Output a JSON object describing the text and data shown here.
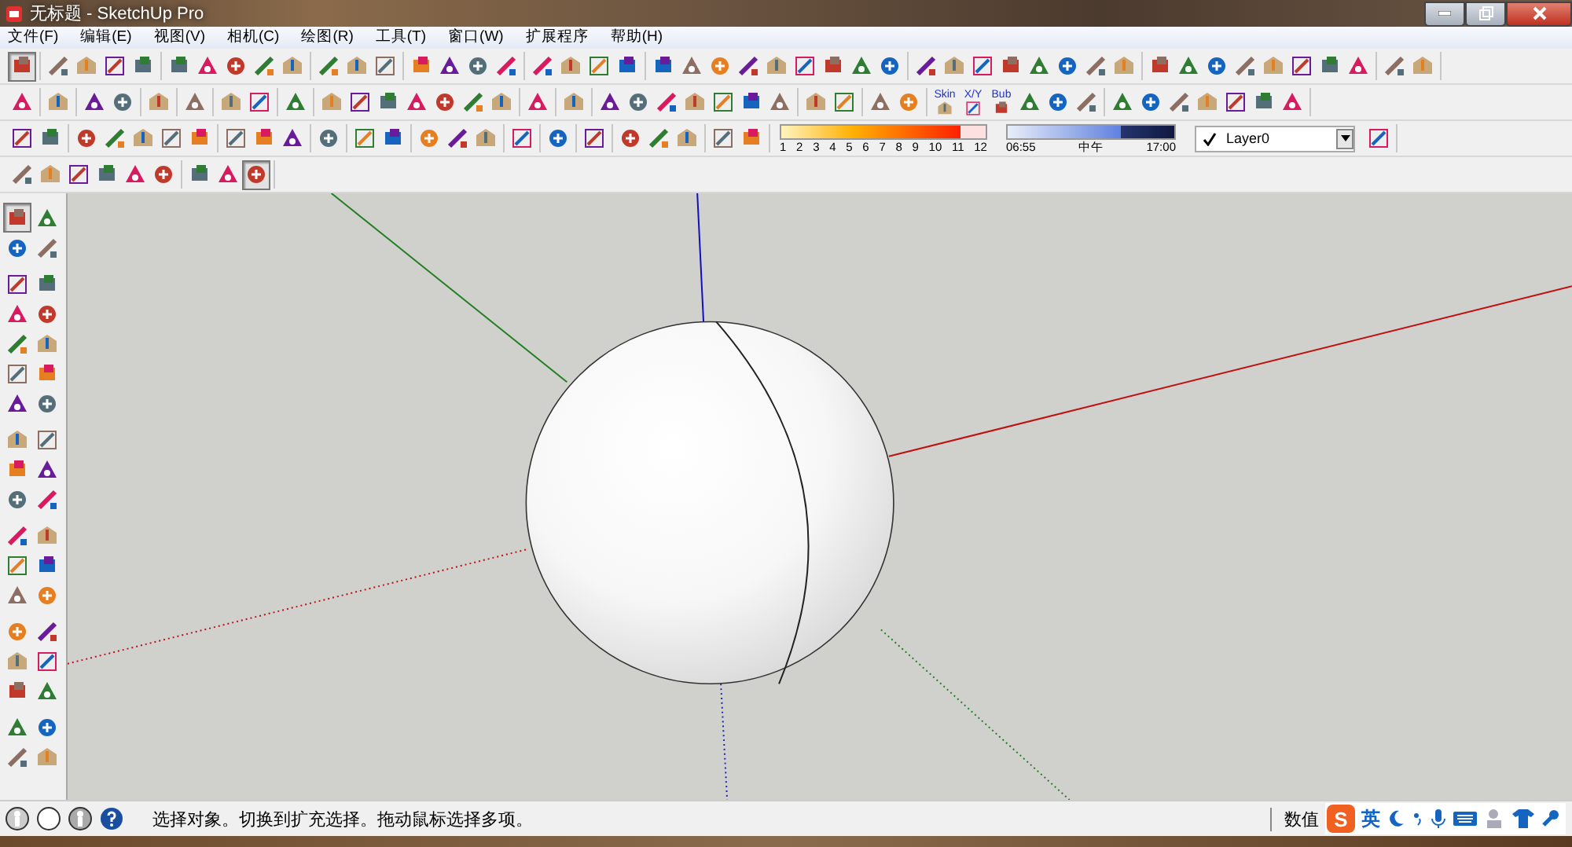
{
  "window": {
    "title": "无标题 - SketchUp Pro"
  },
  "menu": [
    "文件(F)",
    "编辑(E)",
    "视图(V)",
    "相机(C)",
    "绘图(R)",
    "工具(T)",
    "窗口(W)",
    "扩展程序",
    "帮助(H)"
  ],
  "toolbars": [
    {
      "groups": [
        {
          "kind": "tools",
          "tools": [
            {
              "selected": true
            }
          ]
        },
        {
          "kind": "tools",
          "tools": [
            {
              "selected": false
            },
            {
              "selected": false
            },
            {
              "selected": false
            },
            {
              "selected": false
            }
          ]
        },
        {
          "kind": "tools",
          "tools": [
            {
              "selected": false
            },
            {
              "selected": false
            },
            {
              "selected": false
            },
            {
              "selected": false
            },
            {
              "selected": false
            }
          ]
        },
        {
          "kind": "tools",
          "tools": [
            {
              "selected": false
            },
            {
              "selected": false
            },
            {
              "selected": false
            }
          ]
        },
        {
          "kind": "tools",
          "tools": [
            {
              "selected": false
            },
            {
              "selected": false
            },
            {
              "selected": false
            },
            {
              "selected": false
            }
          ]
        },
        {
          "kind": "tools",
          "tools": [
            {
              "selected": false
            },
            {
              "selected": false
            },
            {
              "selected": false
            },
            {
              "selected": false
            }
          ]
        },
        {
          "kind": "tools",
          "tools": [
            {
              "selected": false
            },
            {
              "selected": false
            },
            {
              "selected": false
            },
            {
              "selected": false
            },
            {
              "selected": false
            },
            {
              "selected": false
            },
            {
              "selected": false
            },
            {
              "selected": false
            },
            {
              "selected": false
            }
          ]
        },
        {
          "kind": "tools",
          "tools": [
            {
              "selected": false
            },
            {
              "selected": false
            },
            {
              "selected": false
            },
            {
              "selected": false
            },
            {
              "selected": false
            },
            {
              "selected": false
            },
            {
              "selected": false
            },
            {
              "selected": false
            }
          ]
        },
        {
          "kind": "tools",
          "tools": [
            {
              "selected": false
            },
            {
              "selected": false
            },
            {
              "selected": false
            },
            {
              "selected": false
            },
            {
              "selected": false
            },
            {
              "selected": false
            },
            {
              "selected": false
            },
            {
              "selected": false
            }
          ]
        },
        {
          "kind": "tools",
          "tools": [
            {
              "selected": false
            },
            {
              "selected": false
            }
          ]
        }
      ]
    },
    {
      "groups": [
        {
          "kind": "tools",
          "tools": [
            {
              "selected": false
            }
          ]
        },
        {
          "kind": "tools",
          "tools": [
            {
              "selected": false
            }
          ]
        },
        {
          "kind": "tools",
          "tools": [
            {
              "selected": false
            },
            {
              "selected": false
            }
          ]
        },
        {
          "kind": "tools",
          "tools": [
            {
              "selected": false
            }
          ]
        },
        {
          "kind": "tools",
          "tools": [
            {
              "selected": false
            }
          ]
        },
        {
          "kind": "tools",
          "tools": [
            {
              "selected": false
            },
            {
              "selected": false
            }
          ]
        },
        {
          "kind": "tools",
          "tools": [
            {
              "selected": false
            }
          ]
        },
        {
          "kind": "tools",
          "tools": [
            {
              "selected": false
            },
            {
              "selected": false
            },
            {
              "selected": false
            },
            {
              "selected": false
            },
            {
              "selected": false
            },
            {
              "selected": false
            },
            {
              "selected": false
            }
          ]
        },
        {
          "kind": "tools",
          "tools": [
            {
              "selected": false
            }
          ]
        },
        {
          "kind": "tools",
          "tools": [
            {
              "selected": false
            }
          ]
        },
        {
          "kind": "tools",
          "tools": [
            {
              "selected": false
            },
            {
              "selected": false
            },
            {
              "selected": false
            },
            {
              "selected": false
            },
            {
              "selected": false
            },
            {
              "selected": false
            },
            {
              "selected": false
            }
          ]
        },
        {
          "kind": "tools",
          "tools": [
            {
              "selected": false
            },
            {
              "selected": false
            }
          ]
        },
        {
          "kind": "tools",
          "tools": [
            {
              "selected": false
            },
            {
              "selected": false
            }
          ]
        },
        {
          "kind": "tools",
          "tools": [
            {
              "selected": false,
              "label": "Skin"
            },
            {
              "selected": false,
              "label": "X/Y"
            },
            {
              "selected": false,
              "label": "Bub"
            },
            {
              "selected": false
            },
            {
              "selected": false
            },
            {
              "selected": false
            }
          ]
        },
        {
          "kind": "tools",
          "tools": [
            {
              "selected": false
            },
            {
              "selected": false
            },
            {
              "selected": false
            },
            {
              "selected": false
            },
            {
              "selected": false
            },
            {
              "selected": false
            },
            {
              "selected": false
            }
          ]
        }
      ]
    },
    {
      "groups": [
        {
          "kind": "tools",
          "tools": [
            {
              "selected": false
            },
            {
              "selected": false
            }
          ]
        },
        {
          "kind": "tools",
          "tools": [
            {
              "selected": false
            },
            {
              "selected": false
            },
            {
              "selected": false
            },
            {
              "selected": false
            },
            {
              "selected": false
            }
          ]
        },
        {
          "kind": "tools",
          "tools": [
            {
              "selected": false
            },
            {
              "selected": false
            },
            {
              "selected": false
            }
          ]
        },
        {
          "kind": "tools",
          "tools": [
            {
              "selected": false
            }
          ]
        },
        {
          "kind": "tools",
          "tools": [
            {
              "selected": false
            },
            {
              "selected": false
            }
          ]
        },
        {
          "kind": "tools",
          "tools": [
            {
              "selected": false
            },
            {
              "selected": false
            },
            {
              "selected": false
            }
          ]
        },
        {
          "kind": "tools",
          "tools": [
            {
              "selected": false
            }
          ]
        },
        {
          "kind": "tools",
          "tools": [
            {
              "selected": false
            }
          ]
        },
        {
          "kind": "tools",
          "tools": [
            {
              "selected": false
            }
          ]
        },
        {
          "kind": "tools",
          "tools": [
            {
              "selected": false
            },
            {
              "selected": false
            },
            {
              "selected": false
            }
          ]
        },
        {
          "kind": "tools",
          "tools": [
            {
              "selected": false
            },
            {
              "selected": false
            }
          ]
        },
        {
          "kind": "shadow_scale",
          "labels": [
            "1",
            "2",
            "3",
            "4",
            "5",
            "6",
            "7",
            "8",
            "9",
            "10",
            "11",
            "12"
          ],
          "level": 0.88
        },
        {
          "kind": "time_scale",
          "start": "06:55",
          "middle": "中午",
          "end": "17:00",
          "level": 0.68
        },
        {
          "kind": "layer",
          "value": "Layer0",
          "checked": true
        },
        {
          "kind": "tools",
          "tools": [
            {
              "selected": false
            }
          ]
        }
      ]
    },
    {
      "groups": [
        {
          "kind": "tools",
          "tools": [
            {
              "selected": false
            },
            {
              "selected": false
            },
            {
              "selected": false
            },
            {
              "selected": false
            },
            {
              "selected": false
            },
            {
              "selected": false
            }
          ]
        },
        {
          "kind": "tools",
          "tools": [
            {
              "selected": false
            },
            {
              "selected": false
            },
            {
              "selected": true
            }
          ]
        }
      ]
    }
  ],
  "left_toolbar": [
    [
      {
        "selected": true
      },
      {
        "selected": false
      },
      {
        "selected": false
      },
      {
        "selected": false
      }
    ],
    [
      {
        "selected": false
      },
      {
        "selected": false
      },
      {
        "selected": false
      },
      {
        "selected": false
      },
      {
        "selected": false
      },
      {
        "selected": false
      },
      {
        "selected": false
      },
      {
        "selected": false
      },
      {
        "selected": false
      },
      {
        "selected": false
      }
    ],
    [
      {
        "selected": false
      },
      {
        "selected": false
      },
      {
        "selected": false
      },
      {
        "selected": false
      },
      {
        "selected": false
      },
      {
        "selected": false
      }
    ],
    [
      {
        "selected": false
      },
      {
        "selected": false
      },
      {
        "selected": false
      },
      {
        "selected": false
      },
      {
        "selected": false
      },
      {
        "selected": false
      }
    ],
    [
      {
        "selected": false
      },
      {
        "selected": false
      },
      {
        "selected": false
      },
      {
        "selected": false
      },
      {
        "selected": false
      },
      {
        "selected": false
      }
    ],
    [
      {
        "selected": false
      },
      {
        "selected": false
      },
      {
        "selected": false
      },
      {
        "selected": false
      }
    ]
  ],
  "status_bar": {
    "hint": "选择对象。切换到扩充选择。拖动鼠标选择多项。",
    "measurements_label": "数值"
  },
  "ime": {
    "logo": "S",
    "mode": "英"
  }
}
